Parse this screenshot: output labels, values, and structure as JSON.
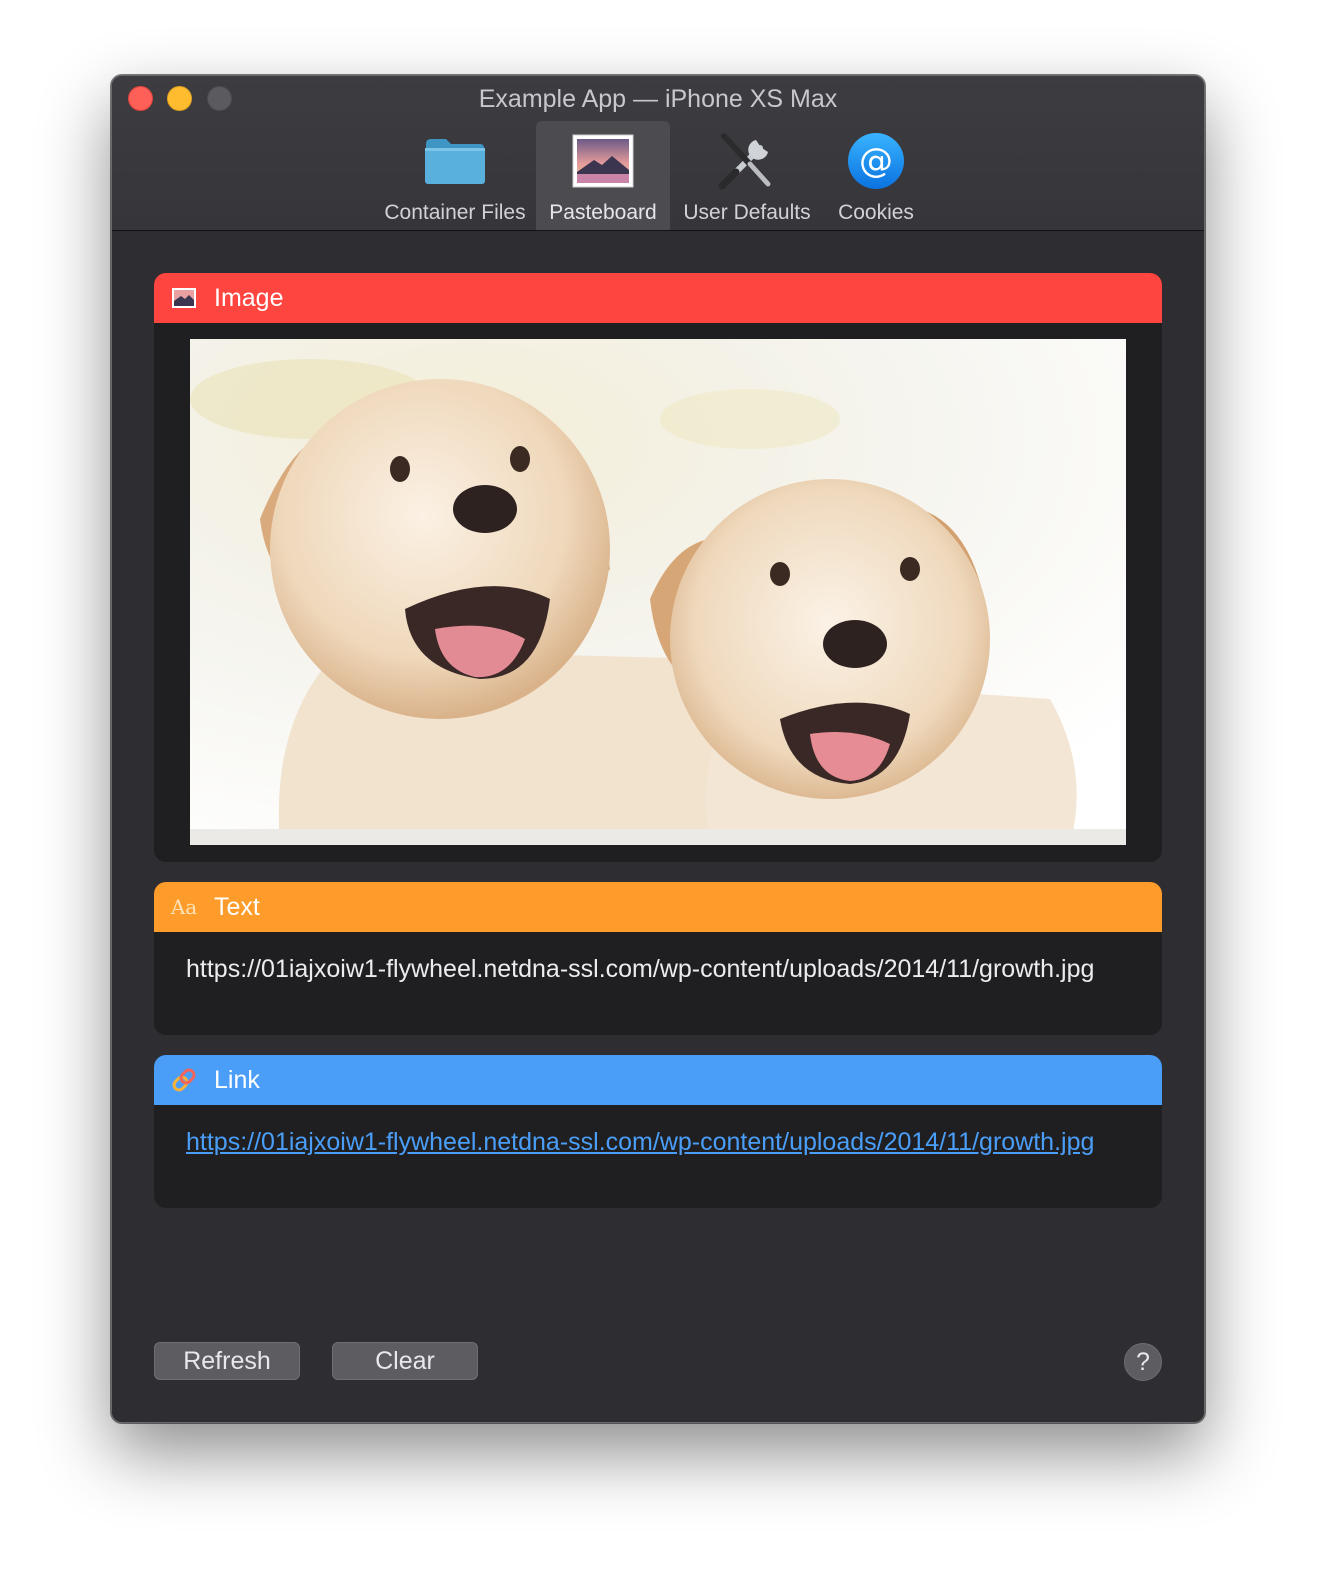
{
  "window": {
    "title": "Example App — iPhone XS Max"
  },
  "toolbar": {
    "items": [
      {
        "label": "Container Files",
        "icon": "folder-icon",
        "selected": false
      },
      {
        "label": "Pasteboard",
        "icon": "picture-icon",
        "selected": true
      },
      {
        "label": "User Defaults",
        "icon": "tools-icon",
        "selected": false
      },
      {
        "label": "Cookies",
        "icon": "at-sign-icon",
        "selected": false
      }
    ]
  },
  "cards": {
    "image": {
      "title": "Image",
      "icon": "picture-icon",
      "color": "#ff4540"
    },
    "text": {
      "title": "Text",
      "icon": "text-aa-icon",
      "icon_text": "Aa",
      "color": "#fe9c2b",
      "value": "https://01iajxoiw1-flywheel.netdna-ssl.com/wp-content/uploads/2014/11/growth.jpg"
    },
    "link": {
      "title": "Link",
      "icon": "link-icon",
      "color": "#4a9ef8",
      "value": "https://01iajxoiw1-flywheel.netdna-ssl.com/wp-content/uploads/2014/11/growth.jpg"
    }
  },
  "buttons": {
    "refresh": "Refresh",
    "clear": "Clear",
    "help": "?"
  }
}
